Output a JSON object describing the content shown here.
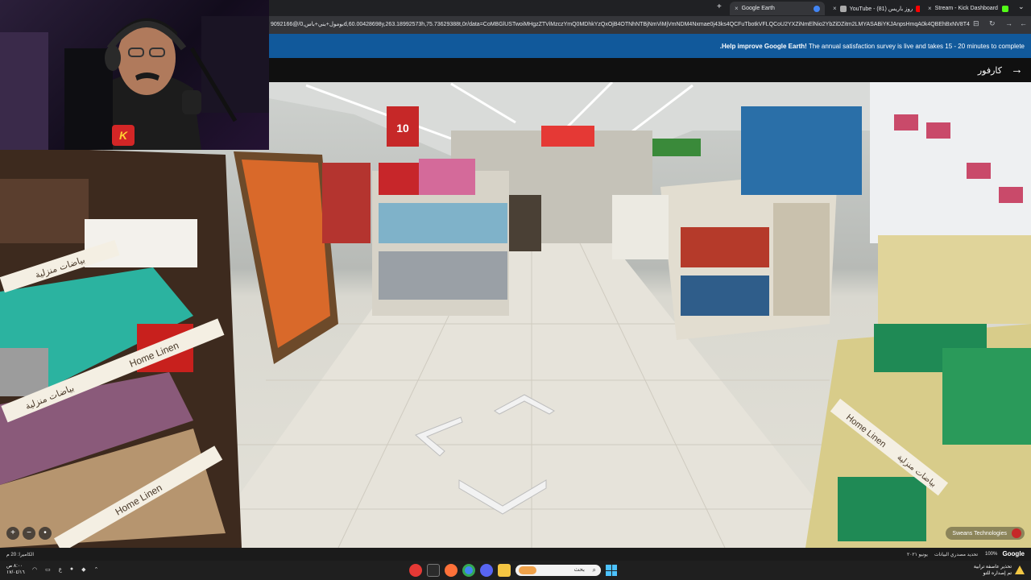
{
  "browser": {
    "tabs": [
      {
        "label": "Google Earth",
        "active": true,
        "icon_color": "#4285f4"
      },
      {
        "label": "YouTube - روز باريس (81)",
        "active": false,
        "icon_color": "#ff0000"
      },
      {
        "label": "Stream - Kick Dashboard",
        "active": false,
        "icon_color": "#53fc18"
      }
    ],
    "new_tab": "+",
    "close_glyph": "×",
    "url": "9092166@/بومول+بني+باس,0d,60.00428698y,263.18992573h,75.73629388t,0r/data=CoMBGlUSTwoiMHgzZTViMzczYmQ0MDhkYzQxOjB4OTNhNTBjNmViMjVmNDM4Nxmae0j43ks4QCFuTbotkVFLQCoU2YXZiNmElNio2YbZiDZitm2LMYASABiYKJAnpsHmqA0k4QBEhBxNV8T44QBnV..."
  },
  "survey_banner": {
    "prefix": ".Help improve Google Earth!",
    "text": " The annual satisfaction survey is live and takes 15 - 20 minutes to complete"
  },
  "place": {
    "name": "كارفور",
    "back_icon": "→"
  },
  "scene": {
    "signs": {
      "home_linen_ar": "بياضات منزلية",
      "home_linen_en": "Home Linen",
      "price_tag": "10"
    },
    "zoom": {
      "in": "+",
      "out": "−"
    },
    "attribution": "Sweans Technologies"
  },
  "earth_status": {
    "camera": "الكاميرا: 20 م",
    "date": "يونيو ٢٠٢١",
    "data_source": "تحديد مصدري البيانات",
    "zoom_level": "100%",
    "brand": "Google"
  },
  "taskbar": {
    "time": "٨:٠٠ ص",
    "date": "١٧/٠٤/١٦",
    "tray": [
      "ع",
      "⌃"
    ],
    "search_placeholder": "بحث",
    "weather_line1": "تحذير عاصفة ترابية",
    "weather_line2": "تم إصداره للتو"
  },
  "colors": {
    "survey_blue": "#11599b",
    "kick_red": "#d32626",
    "floor_sign_blue": "#1e6fc1"
  }
}
